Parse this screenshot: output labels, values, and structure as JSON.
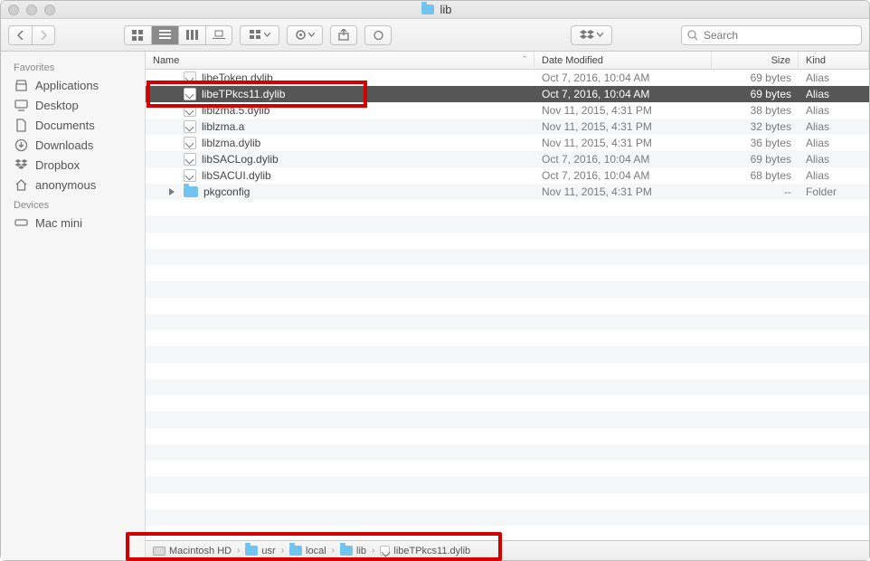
{
  "window": {
    "title": "lib",
    "search_placeholder": "Search"
  },
  "sidebar": {
    "groups": [
      {
        "label": "Favorites",
        "items": [
          {
            "icon": "applications",
            "label": "Applications"
          },
          {
            "icon": "desktop",
            "label": "Desktop"
          },
          {
            "icon": "documents",
            "label": "Documents"
          },
          {
            "icon": "downloads",
            "label": "Downloads"
          },
          {
            "icon": "dropbox",
            "label": "Dropbox"
          },
          {
            "icon": "home",
            "label": "anonymous"
          }
        ]
      },
      {
        "label": "Devices",
        "items": [
          {
            "icon": "macmini",
            "label": "Mac mini"
          }
        ]
      }
    ]
  },
  "columns": {
    "name": "Name",
    "date": "Date Modified",
    "size": "Size",
    "kind": "Kind"
  },
  "files": [
    {
      "name": "libeToken.dylib",
      "date": "Oct 7, 2016, 10:04 AM",
      "size": "69 bytes",
      "kind": "Alias",
      "icon": "alias",
      "selected": false
    },
    {
      "name": "libeTPkcs11.dylib",
      "date": "Oct 7, 2016, 10:04 AM",
      "size": "69 bytes",
      "kind": "Alias",
      "icon": "alias",
      "selected": true
    },
    {
      "name": "liblzma.5.dylib",
      "date": "Nov 11, 2015, 4:31 PM",
      "size": "38 bytes",
      "kind": "Alias",
      "icon": "alias",
      "selected": false
    },
    {
      "name": "liblzma.a",
      "date": "Nov 11, 2015, 4:31 PM",
      "size": "32 bytes",
      "kind": "Alias",
      "icon": "alias",
      "selected": false
    },
    {
      "name": "liblzma.dylib",
      "date": "Nov 11, 2015, 4:31 PM",
      "size": "36 bytes",
      "kind": "Alias",
      "icon": "alias",
      "selected": false
    },
    {
      "name": "libSACLog.dylib",
      "date": "Oct 7, 2016, 10:04 AM",
      "size": "69 bytes",
      "kind": "Alias",
      "icon": "alias",
      "selected": false
    },
    {
      "name": "libSACUI.dylib",
      "date": "Oct 7, 2016, 10:04 AM",
      "size": "68 bytes",
      "kind": "Alias",
      "icon": "alias",
      "selected": false
    },
    {
      "name": "pkgconfig",
      "date": "Nov 11, 2015, 4:31 PM",
      "size": "--",
      "kind": "Folder",
      "icon": "folder",
      "selected": false,
      "disclose": true
    }
  ],
  "path": [
    {
      "icon": "hd",
      "label": "Macintosh HD"
    },
    {
      "icon": "folder",
      "label": "usr"
    },
    {
      "icon": "folder",
      "label": "local"
    },
    {
      "icon": "folder",
      "label": "lib"
    },
    {
      "icon": "alias",
      "label": "libeTPkcs11.dylib"
    }
  ]
}
